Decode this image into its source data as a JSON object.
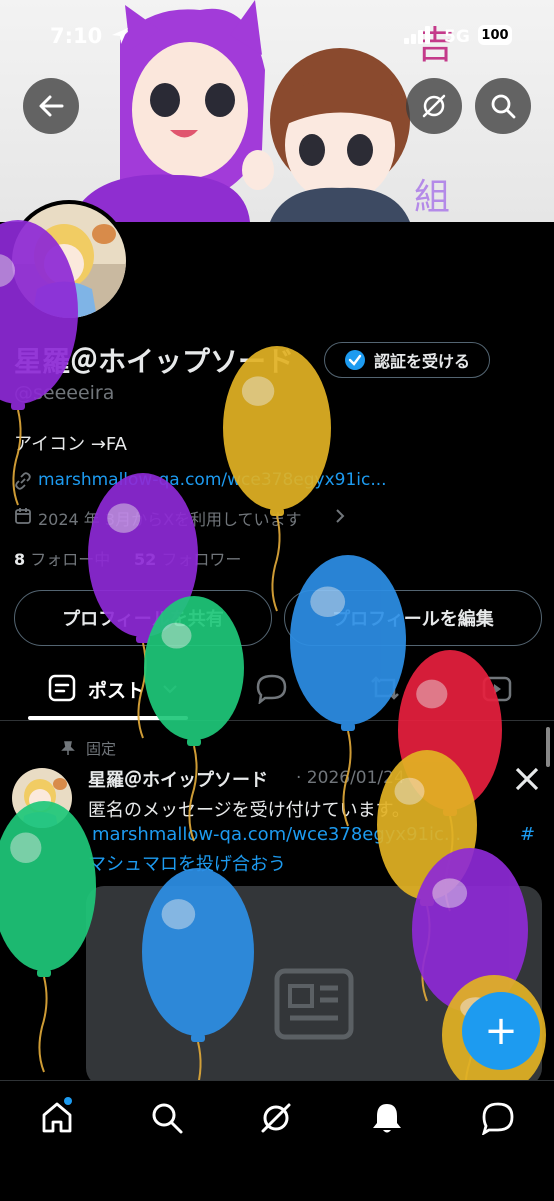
{
  "status_bar": {
    "time": "7:10",
    "network": "5G",
    "battery": "100"
  },
  "banner": {
    "text_top": "吉",
    "text_bottom": "組"
  },
  "profile": {
    "display_name": "星羅＠ホイップソード",
    "verify_label": "認証を受ける",
    "handle": "@seeeeira",
    "bio": "アイコン →FA",
    "link": "marshmallow-qa.com/wce378egyx91ic...",
    "joined": "2024 年 3月からXを利用しています",
    "following_count": "8",
    "following_label": "フォロー中",
    "followers_count": "52",
    "followers_label": "フォロワー"
  },
  "actions": {
    "share_label": "プロフィールを共有",
    "edit_label": "プロフィールを編集"
  },
  "tabs": {
    "posts_label": "ポスト"
  },
  "post": {
    "pinned_label": "固定",
    "author": "星羅＠ホイップソード",
    "date": "· 2026/01/24",
    "text": "匿名のメッセージを受け付けています。",
    "link": "marshmallow-qa.com/wce378egyx91ic...",
    "hashtag_prefix": "#",
    "hashtag": "マシュマロを投げ合おう"
  },
  "fab": {
    "label": "+"
  },
  "colors": {
    "accent": "#1d9bf0",
    "balloon_purple": "#8e2ad6",
    "balloon_yellow": "#e2b224",
    "balloon_green": "#1fc87a",
    "balloon_blue": "#2d8fe6",
    "balloon_red": "#e8203e"
  }
}
